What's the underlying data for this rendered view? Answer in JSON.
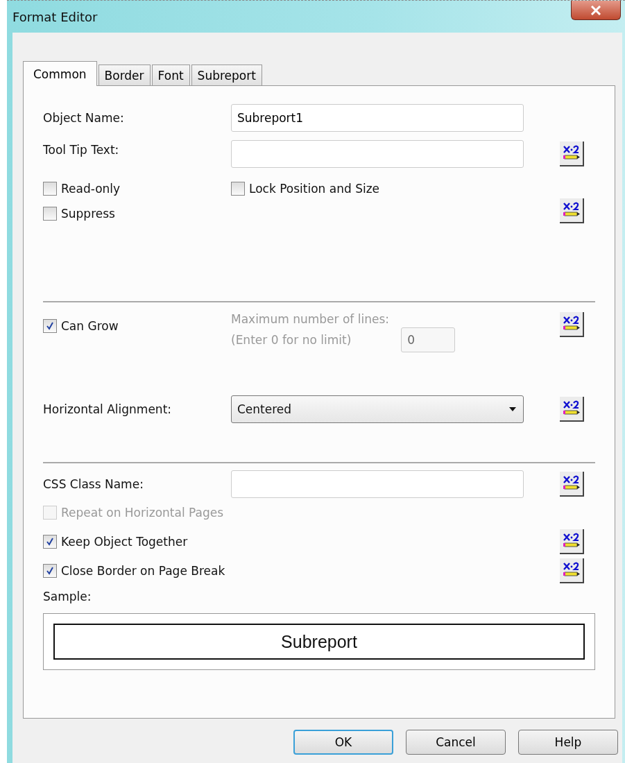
{
  "window": {
    "title": "Format Editor"
  },
  "tabs": [
    {
      "label": "Common",
      "selected": true
    },
    {
      "label": "Border",
      "selected": false
    },
    {
      "label": "Font",
      "selected": false
    },
    {
      "label": "Subreport",
      "selected": false
    }
  ],
  "object_name": {
    "label": "Object Name:",
    "value": "Subreport1"
  },
  "tooltip_text": {
    "label": "Tool Tip Text:"
  },
  "read_only": {
    "label": "Read-only",
    "checked": false
  },
  "lock_position_and_size": {
    "label": "Lock Position and Size",
    "checked": false
  },
  "suppress": {
    "label": "Suppress",
    "checked": false
  },
  "can_grow": {
    "label": "Can Grow",
    "checked": true
  },
  "max_lines": {
    "label": "Maximum number of lines:",
    "hint": "(Enter 0 for no limit)",
    "value": "0",
    "disabled": true
  },
  "horizontal_alignment": {
    "label": "Horizontal Alignment:",
    "value": "Centered"
  },
  "css_class_name": {
    "label": "CSS Class Name:"
  },
  "repeat_on_horizontal_pages": {
    "label": "Repeat on Horizontal Pages",
    "checked": false,
    "disabled": true
  },
  "keep_object_together": {
    "label": "Keep Object Together",
    "checked": true
  },
  "close_border_on_page_break": {
    "label": "Close Border on Page Break",
    "checked": true
  },
  "sample": {
    "label": "Sample:",
    "text": "Subreport"
  },
  "buttons": [
    {
      "label": "OK",
      "default": true
    },
    {
      "label": "Cancel",
      "default": false
    },
    {
      "label": "Help",
      "default": false
    }
  ]
}
